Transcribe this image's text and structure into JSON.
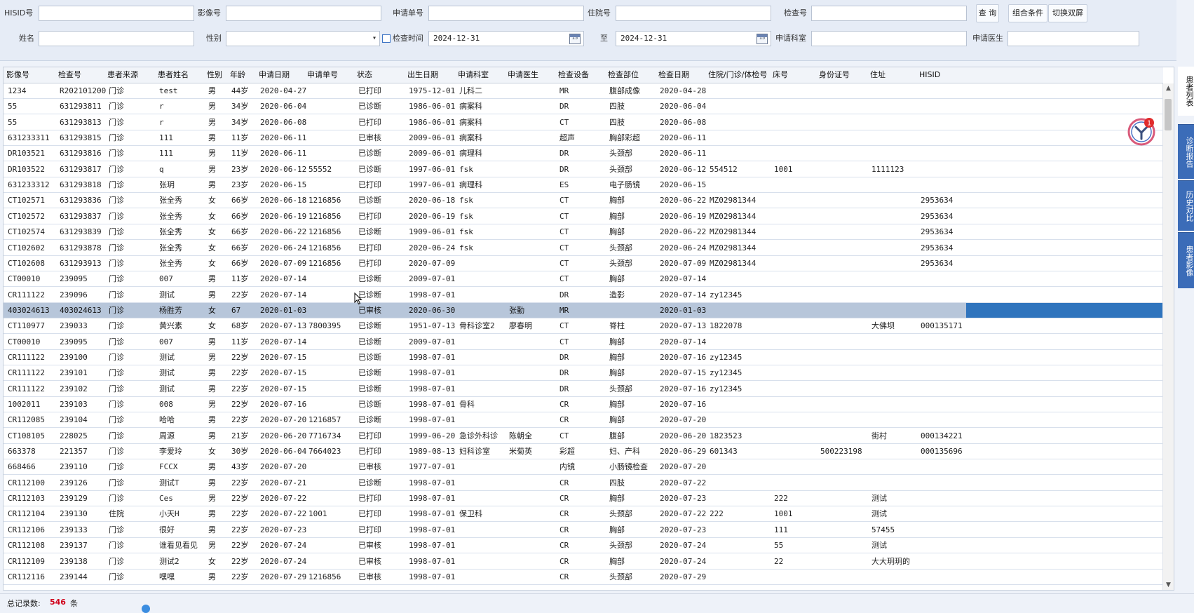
{
  "search": {
    "hisid_label": "HISID号",
    "image_no_label": "影像号",
    "apply_no_label": "申请单号",
    "inpatient_no_label": "住院号",
    "exam_no_label": "检查号",
    "query_button": "查 询",
    "combo_button": "组合条件",
    "dual_screen_button": "切换双屏",
    "name_label": "姓名",
    "gender_label": "性别",
    "exam_time_label": "检查时间",
    "date_from": "2024-12-31",
    "to_label": "至",
    "date_to": "2024-12-31",
    "dept_label": "申请科室",
    "doctor_label": "申请医生"
  },
  "columns": [
    "影像号",
    "检查号",
    "患者来源",
    "患者姓名",
    "性别",
    "年龄",
    "申请日期",
    "申请单号",
    "状态",
    "出生日期",
    "申请科室",
    "申请医生",
    "检查设备",
    "检查部位",
    "检查日期",
    "住院/门诊/体检号",
    "床号",
    "身份证号",
    "住址",
    "HISID"
  ],
  "rows": [
    [
      "1234",
      "R202101200",
      "门诊",
      "test",
      "男",
      "44岁",
      "2020-04-27",
      "",
      "已打印",
      "1975-12-01",
      "儿科二",
      "",
      "MR",
      "腹部成像",
      "2020-04-28",
      "",
      "",
      "",
      "",
      ""
    ],
    [
      "55",
      "631293811",
      "门诊",
      "r",
      "男",
      "34岁",
      "2020-06-04",
      "",
      "已诊断",
      "1986-06-01",
      "病案科",
      "",
      "DR",
      "四肢",
      "2020-06-04",
      "",
      "",
      "",
      "",
      ""
    ],
    [
      "55",
      "631293813",
      "门诊",
      "r",
      "男",
      "34岁",
      "2020-06-08",
      "",
      "已打印",
      "1986-06-01",
      "病案科",
      "",
      "CT",
      "四肢",
      "2020-06-08",
      "",
      "",
      "",
      "",
      ""
    ],
    [
      "631233311",
      "631293815",
      "门诊",
      "111",
      "男",
      "11岁",
      "2020-06-11",
      "",
      "已审核",
      "2009-06-01",
      "病案科",
      "",
      "超声",
      "胸部彩超",
      "2020-06-11",
      "",
      "",
      "",
      "",
      ""
    ],
    [
      "DR103521",
      "631293816",
      "门诊",
      "111",
      "男",
      "11岁",
      "2020-06-11",
      "",
      "已诊断",
      "2009-06-01",
      "病理科",
      "",
      "DR",
      "头颈部",
      "2020-06-11",
      "",
      "",
      "",
      "",
      ""
    ],
    [
      "DR103522",
      "631293817",
      "门诊",
      "q",
      "男",
      "23岁",
      "2020-06-12",
      "55552",
      "已诊断",
      "1997-06-01",
      "fsk",
      "",
      "DR",
      "头颈部",
      "2020-06-12",
      "554512",
      "1001",
      "",
      "1111123",
      ""
    ],
    [
      "631233312",
      "631293818",
      "门诊",
      "张玥",
      "男",
      "23岁",
      "2020-06-15",
      "",
      "已打印",
      "1997-06-01",
      "病理科",
      "",
      "ES",
      "电子肠镜",
      "2020-06-15",
      "",
      "",
      "",
      "",
      ""
    ],
    [
      "CT102571",
      "631293836",
      "门诊",
      "张全秀",
      "女",
      "66岁",
      "2020-06-18",
      "1216856",
      "已诊断",
      "2020-06-18",
      "fsk",
      "",
      "CT",
      "胸部",
      "2020-06-22",
      "MZ02981344",
      "",
      "",
      "",
      "2953634"
    ],
    [
      "CT102572",
      "631293837",
      "门诊",
      "张全秀",
      "女",
      "66岁",
      "2020-06-19",
      "1216856",
      "已打印",
      "2020-06-19",
      "fsk",
      "",
      "CT",
      "胸部",
      "2020-06-19",
      "MZ02981344",
      "",
      "",
      "",
      "2953634"
    ],
    [
      "CT102574",
      "631293839",
      "门诊",
      "张全秀",
      "女",
      "66岁",
      "2020-06-22",
      "1216856",
      "已诊断",
      "1909-06-01",
      "fsk",
      "",
      "CT",
      "胸部",
      "2020-06-22",
      "MZ02981344",
      "",
      "",
      "",
      "2953634"
    ],
    [
      "CT102602",
      "631293878",
      "门诊",
      "张全秀",
      "女",
      "66岁",
      "2020-06-24",
      "1216856",
      "已打印",
      "2020-06-24",
      "fsk",
      "",
      "CT",
      "头颈部",
      "2020-06-24",
      "MZ02981344",
      "",
      "",
      "",
      "2953634"
    ],
    [
      "CT102608",
      "631293913",
      "门诊",
      "张全秀",
      "女",
      "66岁",
      "2020-07-09",
      "1216856",
      "已打印",
      "2020-07-09",
      "",
      "",
      "CT",
      "头颈部",
      "2020-07-09",
      "MZ02981344",
      "",
      "",
      "",
      "2953634"
    ],
    [
      "CT00010",
      "239095",
      "门诊",
      "007",
      "男",
      "11岁",
      "2020-07-14",
      "",
      "已诊断",
      "2009-07-01",
      "",
      "",
      "CT",
      "胸部",
      "2020-07-14",
      "",
      "",
      "",
      "",
      ""
    ],
    [
      "CR111122",
      "239096",
      "门诊",
      "测试",
      "男",
      "22岁",
      "2020-07-14",
      "",
      "已诊断",
      "1998-07-01",
      "",
      "",
      "DR",
      "造影",
      "2020-07-14",
      "zy12345",
      "",
      "",
      "",
      ""
    ],
    [
      "403024613",
      "403024613",
      "门诊",
      "杨胜芳",
      "女",
      "67",
      "2020-01-03",
      "",
      "已审核",
      "2020-06-30",
      "",
      "张勤",
      "MR",
      "",
      "2020-01-03",
      "",
      "",
      "",
      "",
      ""
    ],
    [
      "CT110977",
      "239033",
      "门诊",
      "黄兴素",
      "女",
      "68岁",
      "2020-07-13",
      "7800395",
      "已诊断",
      "1951-07-13",
      "骨科诊室2",
      "廖春明",
      "CT",
      "脊柱",
      "2020-07-13",
      "1822078",
      "",
      "",
      "大佛坝",
      "000135171"
    ],
    [
      "CT00010",
      "239095",
      "门诊",
      "007",
      "男",
      "11岁",
      "2020-07-14",
      "",
      "已诊断",
      "2009-07-01",
      "",
      "",
      "CT",
      "胸部",
      "2020-07-14",
      "",
      "",
      "",
      "",
      ""
    ],
    [
      "CR111122",
      "239100",
      "门诊",
      "测试",
      "男",
      "22岁",
      "2020-07-15",
      "",
      "已诊断",
      "1998-07-01",
      "",
      "",
      "DR",
      "胸部",
      "2020-07-16",
      "zy12345",
      "",
      "",
      "",
      ""
    ],
    [
      "CR111122",
      "239101",
      "门诊",
      "测试",
      "男",
      "22岁",
      "2020-07-15",
      "",
      "已诊断",
      "1998-07-01",
      "",
      "",
      "DR",
      "胸部",
      "2020-07-15",
      "zy12345",
      "",
      "",
      "",
      ""
    ],
    [
      "CR111122",
      "239102",
      "门诊",
      "测试",
      "男",
      "22岁",
      "2020-07-15",
      "",
      "已诊断",
      "1998-07-01",
      "",
      "",
      "DR",
      "头颈部",
      "2020-07-16",
      "zy12345",
      "",
      "",
      "",
      ""
    ],
    [
      "1002011",
      "239103",
      "门诊",
      "008",
      "男",
      "22岁",
      "2020-07-16",
      "",
      "已诊断",
      "1998-07-01",
      "骨科",
      "",
      "CR",
      "胸部",
      "2020-07-16",
      "",
      "",
      "",
      "",
      ""
    ],
    [
      "CR112085",
      "239104",
      "门诊",
      "哈哈",
      "男",
      "22岁",
      "2020-07-20",
      "1216857",
      "已诊断",
      "1998-07-01",
      "",
      "",
      "CR",
      "胸部",
      "2020-07-20",
      "",
      "",
      "",
      "",
      ""
    ],
    [
      "CT108105",
      "228025",
      "门诊",
      "周源",
      "男",
      "21岁",
      "2020-06-20",
      "7716734",
      "已打印",
      "1999-06-20",
      "急诊外科诊",
      "陈朝全",
      "CT",
      "腹部",
      "2020-06-20",
      "1823523",
      "",
      "",
      "街村",
      "000134221"
    ],
    [
      "663378",
      "221357",
      "门诊",
      "李爱玲",
      "女",
      "30岁",
      "2020-06-04",
      "7664023",
      "已打印",
      "1989-08-13",
      "妇科诊室",
      "米菊英",
      "彩超",
      "妇、产科",
      "2020-06-29",
      "601343",
      "",
      "500223198",
      "",
      "000135696"
    ],
    [
      "668466",
      "239110",
      "门诊",
      "FCCX",
      "男",
      "43岁",
      "2020-07-20",
      "",
      "已审核",
      "1977-07-01",
      "",
      "",
      "内镜",
      "小肠镜检查",
      "2020-07-20",
      "",
      "",
      "",
      "",
      ""
    ],
    [
      "CR112100",
      "239126",
      "门诊",
      "测试T",
      "男",
      "22岁",
      "2020-07-21",
      "",
      "已诊断",
      "1998-07-01",
      "",
      "",
      "CR",
      "四肢",
      "2020-07-22",
      "",
      "",
      "",
      "",
      ""
    ],
    [
      "CR112103",
      "239129",
      "门诊",
      "Ces",
      "男",
      "22岁",
      "2020-07-22",
      "",
      "已打印",
      "1998-07-01",
      "",
      "",
      "CR",
      "胸部",
      "2020-07-23",
      "",
      "222",
      "",
      "测试",
      ""
    ],
    [
      "CR112104",
      "239130",
      "住院",
      "小天H",
      "男",
      "22岁",
      "2020-07-22",
      "1001",
      "已打印",
      "1998-07-01",
      "保卫科",
      "",
      "CR",
      "头颈部",
      "2020-07-22",
      "222",
      "1001",
      "",
      "测试",
      ""
    ],
    [
      "CR112106",
      "239133",
      "门诊",
      "很好",
      "男",
      "22岁",
      "2020-07-23",
      "",
      "已打印",
      "1998-07-01",
      "",
      "",
      "CR",
      "胸部",
      "2020-07-23",
      "",
      "111",
      "",
      "57455",
      ""
    ],
    [
      "CR112108",
      "239137",
      "门诊",
      "谁看见看见",
      "男",
      "22岁",
      "2020-07-24",
      "",
      "已审核",
      "1998-07-01",
      "",
      "",
      "CR",
      "头颈部",
      "2020-07-24",
      "",
      "55",
      "",
      "测试",
      ""
    ],
    [
      "CR112109",
      "239138",
      "门诊",
      "测试2",
      "女",
      "22岁",
      "2020-07-24",
      "",
      "已审核",
      "1998-07-01",
      "",
      "",
      "CR",
      "胸部",
      "2020-07-24",
      "",
      "22",
      "",
      "大大玥玥的",
      ""
    ],
    [
      "CR112116",
      "239144",
      "门诊",
      "嘿嘿",
      "男",
      "22岁",
      "2020-07-29",
      "1216856",
      "已审核",
      "1998-07-01",
      "",
      "",
      "CR",
      "头颈部",
      "2020-07-29",
      "",
      "",
      "",
      "",
      ""
    ]
  ],
  "selected_row": 14,
  "right_tabs": [
    "患者列表",
    "诊断报告",
    "历史对比",
    "患者影像"
  ],
  "assistant_badge_count": "1",
  "status": {
    "total_label": "总记录数:",
    "total_value": "546",
    "unit": "条"
  },
  "colors": {
    "selected_row": "#2f74bd",
    "tab_blue": "#3b6cb8",
    "total_value": "#d0021b"
  }
}
